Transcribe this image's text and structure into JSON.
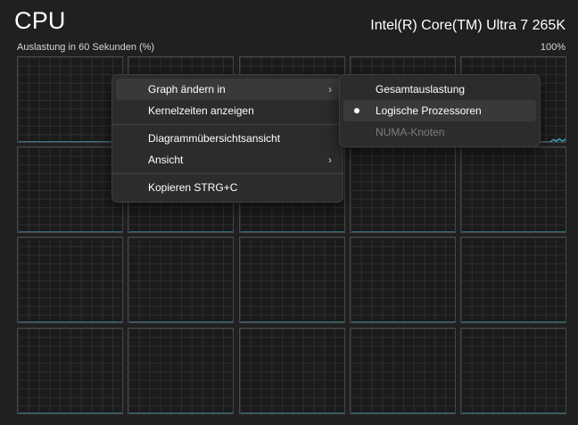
{
  "header": {
    "title": "CPU",
    "cpu_name": "Intel(R) Core(TM) Ultra 7 265K"
  },
  "graph": {
    "usage_label": "Auslastung in 60 Sekunden (%)",
    "max_label": "100%",
    "line_color": "#4cc2e6",
    "fill_color": "#1e4b5e"
  },
  "context_menu": {
    "items": [
      {
        "label": "Graph ändern in",
        "has_submenu": true
      },
      {
        "label": "Kernelzeiten anzeigen"
      },
      {
        "label": "Diagrammübersichtsansicht"
      },
      {
        "label": "Ansicht",
        "has_submenu": true
      },
      {
        "label": "Kopieren STRG+C"
      }
    ]
  },
  "submenu": {
    "items": [
      {
        "label": "Gesamtauslastung"
      },
      {
        "label": "Logische Prozessoren",
        "selected": true
      },
      {
        "label": "NUMA-Knoten",
        "disabled": true
      }
    ]
  },
  "chart_data": {
    "type": "line",
    "title": "",
    "ylim": [
      0,
      100
    ],
    "series": [
      {
        "values": [
          0,
          0,
          0,
          0,
          0,
          0,
          0,
          0,
          0,
          0,
          0,
          0,
          0,
          0,
          0,
          0,
          0,
          0,
          0,
          0,
          0,
          0,
          0,
          0,
          0,
          0,
          0,
          0,
          0,
          0,
          0,
          0,
          0,
          0,
          0,
          0,
          0,
          0,
          0,
          0,
          0,
          0,
          0,
          0,
          0,
          0,
          0,
          0,
          0,
          0,
          0,
          0,
          0,
          0,
          0,
          0,
          0,
          0,
          0,
          0
        ]
      },
      {
        "values": [
          0,
          0,
          0,
          0,
          0,
          0,
          0,
          0,
          0,
          0,
          0,
          0,
          0,
          0,
          0,
          0,
          0,
          0,
          0,
          0,
          0,
          0,
          0,
          0,
          0,
          0,
          0,
          0,
          0,
          0,
          0,
          0,
          0,
          0,
          0,
          0,
          0,
          0,
          0,
          0,
          0,
          0,
          0,
          0,
          0,
          0,
          0,
          0,
          0,
          0,
          0,
          0,
          0,
          0,
          0,
          0,
          0,
          0,
          0,
          0
        ]
      },
      {
        "values": [
          0,
          0,
          0,
          0,
          0,
          0,
          0,
          0,
          0,
          0,
          0,
          0,
          0,
          0,
          0,
          0,
          0,
          0,
          0,
          0,
          0,
          0,
          0,
          0,
          0,
          0,
          0,
          0,
          0,
          0,
          0,
          0,
          0,
          0,
          0,
          0,
          0,
          0,
          0,
          0,
          0,
          0,
          0,
          0,
          0,
          0,
          0,
          0,
          0,
          0,
          0,
          0,
          0,
          0,
          0,
          0,
          0,
          0,
          0,
          0
        ]
      },
      {
        "values": [
          0,
          0,
          0,
          0,
          0,
          0,
          0,
          0,
          0,
          0,
          0,
          0,
          0,
          0,
          0,
          0,
          0,
          0,
          0,
          0,
          0,
          0,
          0,
          0,
          0,
          0,
          0,
          0,
          0,
          0,
          0,
          0,
          0,
          0,
          0,
          0,
          0,
          0,
          0,
          0,
          0,
          0,
          0,
          0,
          0,
          0,
          0,
          0,
          0,
          0,
          0,
          0,
          0,
          0,
          0,
          0,
          0,
          0,
          0,
          0
        ]
      },
      {
        "values": [
          0,
          0,
          0,
          0,
          0,
          0,
          0,
          0,
          0,
          0,
          0,
          0,
          0,
          0,
          0,
          0,
          0,
          0,
          0,
          0,
          0,
          0,
          0,
          0,
          0,
          0,
          0,
          0,
          0,
          0,
          0,
          0,
          0,
          0,
          0,
          0,
          0,
          0,
          0,
          0,
          0,
          0,
          0,
          0,
          0,
          0,
          0,
          0,
          0,
          0,
          0,
          2,
          3,
          1,
          2,
          4,
          2,
          1,
          3,
          2
        ]
      },
      {
        "values": [
          0,
          0,
          0,
          0,
          0,
          0,
          0,
          0,
          0,
          0,
          0,
          0,
          0,
          0,
          0,
          0,
          0,
          0,
          0,
          0,
          0,
          0,
          0,
          0,
          0,
          0,
          0,
          0,
          0,
          0,
          0,
          0,
          0,
          0,
          0,
          0,
          0,
          0,
          0,
          0,
          0,
          0,
          0,
          0,
          0,
          0,
          0,
          0,
          0,
          0,
          0,
          0,
          0,
          0,
          0,
          0,
          0,
          0,
          0,
          0
        ]
      },
      {
        "values": [
          0,
          0,
          0,
          0,
          0,
          0,
          0,
          0,
          0,
          0,
          0,
          0,
          0,
          0,
          0,
          0,
          0,
          0,
          0,
          0,
          0,
          0,
          0,
          0,
          0,
          0,
          0,
          0,
          0,
          0,
          0,
          0,
          0,
          0,
          0,
          0,
          0,
          0,
          0,
          0,
          0,
          0,
          0,
          0,
          0,
          0,
          0,
          0,
          0,
          0,
          0,
          0,
          0,
          0,
          0,
          0,
          0,
          0,
          0,
          0
        ]
      },
      {
        "values": [
          0,
          0,
          0,
          0,
          0,
          0,
          0,
          0,
          0,
          0,
          0,
          0,
          0,
          0,
          0,
          0,
          0,
          0,
          0,
          0,
          0,
          0,
          0,
          0,
          0,
          0,
          0,
          0,
          0,
          0,
          0,
          0,
          0,
          0,
          0,
          0,
          0,
          0,
          0,
          0,
          0,
          0,
          0,
          0,
          0,
          0,
          0,
          0,
          0,
          0,
          0,
          0,
          0,
          0,
          0,
          0,
          0,
          0,
          0,
          0
        ]
      },
      {
        "values": [
          0,
          0,
          0,
          0,
          0,
          0,
          0,
          0,
          0,
          0,
          0,
          0,
          0,
          0,
          0,
          0,
          0,
          0,
          0,
          0,
          0,
          0,
          0,
          0,
          0,
          0,
          0,
          0,
          0,
          0,
          0,
          0,
          0,
          0,
          0,
          0,
          0,
          0,
          0,
          0,
          0,
          0,
          0,
          0,
          0,
          0,
          0,
          0,
          0,
          0,
          0,
          0,
          0,
          0,
          0,
          0,
          0,
          0,
          0,
          0
        ]
      },
      {
        "values": [
          0,
          0,
          0,
          0,
          0,
          0,
          0,
          0,
          0,
          0,
          0,
          0,
          0,
          0,
          0,
          0,
          0,
          0,
          0,
          0,
          0,
          0,
          0,
          0,
          0,
          0,
          0,
          0,
          0,
          0,
          0,
          0,
          0,
          0,
          0,
          0,
          0,
          0,
          0,
          0,
          0,
          0,
          0,
          0,
          0,
          0,
          0,
          0,
          0,
          0,
          0,
          0,
          0,
          0,
          0,
          0,
          0,
          0,
          0,
          0
        ]
      },
      {
        "values": [
          0,
          0,
          0,
          0,
          0,
          0,
          0,
          0,
          0,
          0,
          0,
          0,
          0,
          0,
          0,
          0,
          0,
          0,
          0,
          0,
          0,
          0,
          0,
          0,
          0,
          0,
          0,
          0,
          0,
          0,
          0,
          0,
          0,
          0,
          0,
          0,
          0,
          0,
          0,
          0,
          0,
          0,
          0,
          0,
          0,
          0,
          0,
          0,
          0,
          0,
          0,
          0,
          0,
          0,
          0,
          0,
          0,
          0,
          0,
          0
        ]
      },
      {
        "values": [
          0,
          0,
          0,
          0,
          0,
          0,
          0,
          0,
          0,
          0,
          0,
          0,
          0,
          0,
          0,
          0,
          0,
          0,
          0,
          0,
          0,
          0,
          0,
          0,
          0,
          0,
          0,
          0,
          0,
          0,
          0,
          0,
          0,
          0,
          0,
          0,
          0,
          0,
          0,
          0,
          0,
          0,
          0,
          0,
          0,
          0,
          0,
          0,
          0,
          0,
          0,
          0,
          0,
          0,
          0,
          0,
          0,
          0,
          0,
          0
        ]
      },
      {
        "values": [
          0,
          0,
          0,
          0,
          0,
          0,
          0,
          0,
          0,
          0,
          0,
          0,
          0,
          0,
          0,
          0,
          0,
          0,
          0,
          0,
          0,
          0,
          0,
          0,
          0,
          0,
          0,
          0,
          0,
          0,
          0,
          0,
          0,
          0,
          0,
          0,
          0,
          0,
          0,
          0,
          0,
          0,
          0,
          0,
          0,
          0,
          0,
          0,
          0,
          0,
          0,
          0,
          0,
          0,
          0,
          0,
          0,
          0,
          0,
          0
        ]
      },
      {
        "values": [
          0,
          0,
          0,
          0,
          0,
          0,
          0,
          0,
          0,
          0,
          0,
          0,
          0,
          0,
          0,
          0,
          0,
          0,
          0,
          0,
          0,
          0,
          0,
          0,
          0,
          0,
          0,
          0,
          0,
          0,
          0,
          0,
          0,
          0,
          0,
          0,
          0,
          0,
          0,
          0,
          0,
          0,
          0,
          0,
          0,
          0,
          0,
          0,
          0,
          0,
          0,
          0,
          0,
          0,
          0,
          0,
          0,
          0,
          0,
          0
        ]
      },
      {
        "values": [
          0,
          0,
          0,
          0,
          0,
          0,
          0,
          0,
          0,
          0,
          0,
          0,
          0,
          0,
          0,
          0,
          0,
          0,
          0,
          0,
          0,
          0,
          0,
          0,
          0,
          0,
          0,
          0,
          0,
          0,
          0,
          0,
          0,
          0,
          0,
          0,
          0,
          0,
          0,
          0,
          0,
          0,
          0,
          0,
          0,
          0,
          0,
          0,
          0,
          0,
          0,
          0,
          0,
          0,
          0,
          0,
          0,
          0,
          0,
          0
        ]
      },
      {
        "values": [
          0,
          0,
          0,
          0,
          0,
          0,
          0,
          0,
          0,
          0,
          0,
          0,
          0,
          0,
          0,
          0,
          0,
          0,
          0,
          0,
          0,
          0,
          0,
          0,
          0,
          0,
          0,
          0,
          0,
          0,
          0,
          0,
          0,
          0,
          0,
          0,
          0,
          0,
          0,
          0,
          0,
          0,
          0,
          0,
          0,
          0,
          0,
          0,
          0,
          0,
          0,
          0,
          0,
          0,
          0,
          0,
          0,
          0,
          0,
          0
        ]
      },
      {
        "values": [
          0,
          0,
          0,
          0,
          0,
          0,
          0,
          0,
          0,
          0,
          0,
          0,
          0,
          0,
          0,
          0,
          0,
          0,
          0,
          0,
          0,
          0,
          0,
          0,
          0,
          0,
          0,
          0,
          0,
          0,
          0,
          0,
          0,
          0,
          0,
          0,
          0,
          0,
          0,
          0,
          0,
          0,
          0,
          0,
          0,
          0,
          0,
          0,
          0,
          0,
          0,
          0,
          0,
          0,
          0,
          0,
          0,
          0,
          0,
          0
        ]
      },
      {
        "values": [
          0,
          0,
          0,
          0,
          0,
          0,
          0,
          0,
          0,
          0,
          0,
          0,
          0,
          0,
          0,
          0,
          0,
          0,
          0,
          0,
          0,
          0,
          0,
          0,
          0,
          0,
          0,
          0,
          0,
          0,
          0,
          0,
          0,
          0,
          0,
          0,
          0,
          0,
          0,
          0,
          0,
          0,
          0,
          0,
          0,
          0,
          0,
          0,
          0,
          0,
          0,
          0,
          0,
          0,
          0,
          0,
          0,
          0,
          0,
          0
        ]
      },
      {
        "values": [
          0,
          0,
          0,
          0,
          0,
          0,
          0,
          0,
          0,
          0,
          0,
          0,
          0,
          0,
          0,
          0,
          0,
          0,
          0,
          0,
          0,
          0,
          0,
          0,
          0,
          0,
          0,
          0,
          0,
          0,
          0,
          0,
          0,
          0,
          0,
          0,
          0,
          0,
          0,
          0,
          0,
          0,
          0,
          0,
          0,
          0,
          0,
          0,
          0,
          0,
          0,
          0,
          0,
          0,
          0,
          0,
          0,
          0,
          0,
          0
        ]
      },
      {
        "values": [
          0,
          0,
          0,
          0,
          0,
          0,
          0,
          0,
          0,
          0,
          0,
          0,
          0,
          0,
          0,
          0,
          0,
          0,
          0,
          0,
          0,
          0,
          0,
          0,
          0,
          0,
          0,
          0,
          0,
          0,
          0,
          0,
          0,
          0,
          0,
          0,
          0,
          0,
          0,
          0,
          0,
          0,
          0,
          0,
          0,
          0,
          0,
          0,
          0,
          0,
          0,
          0,
          0,
          0,
          0,
          0,
          0,
          0,
          0,
          0
        ]
      }
    ]
  }
}
